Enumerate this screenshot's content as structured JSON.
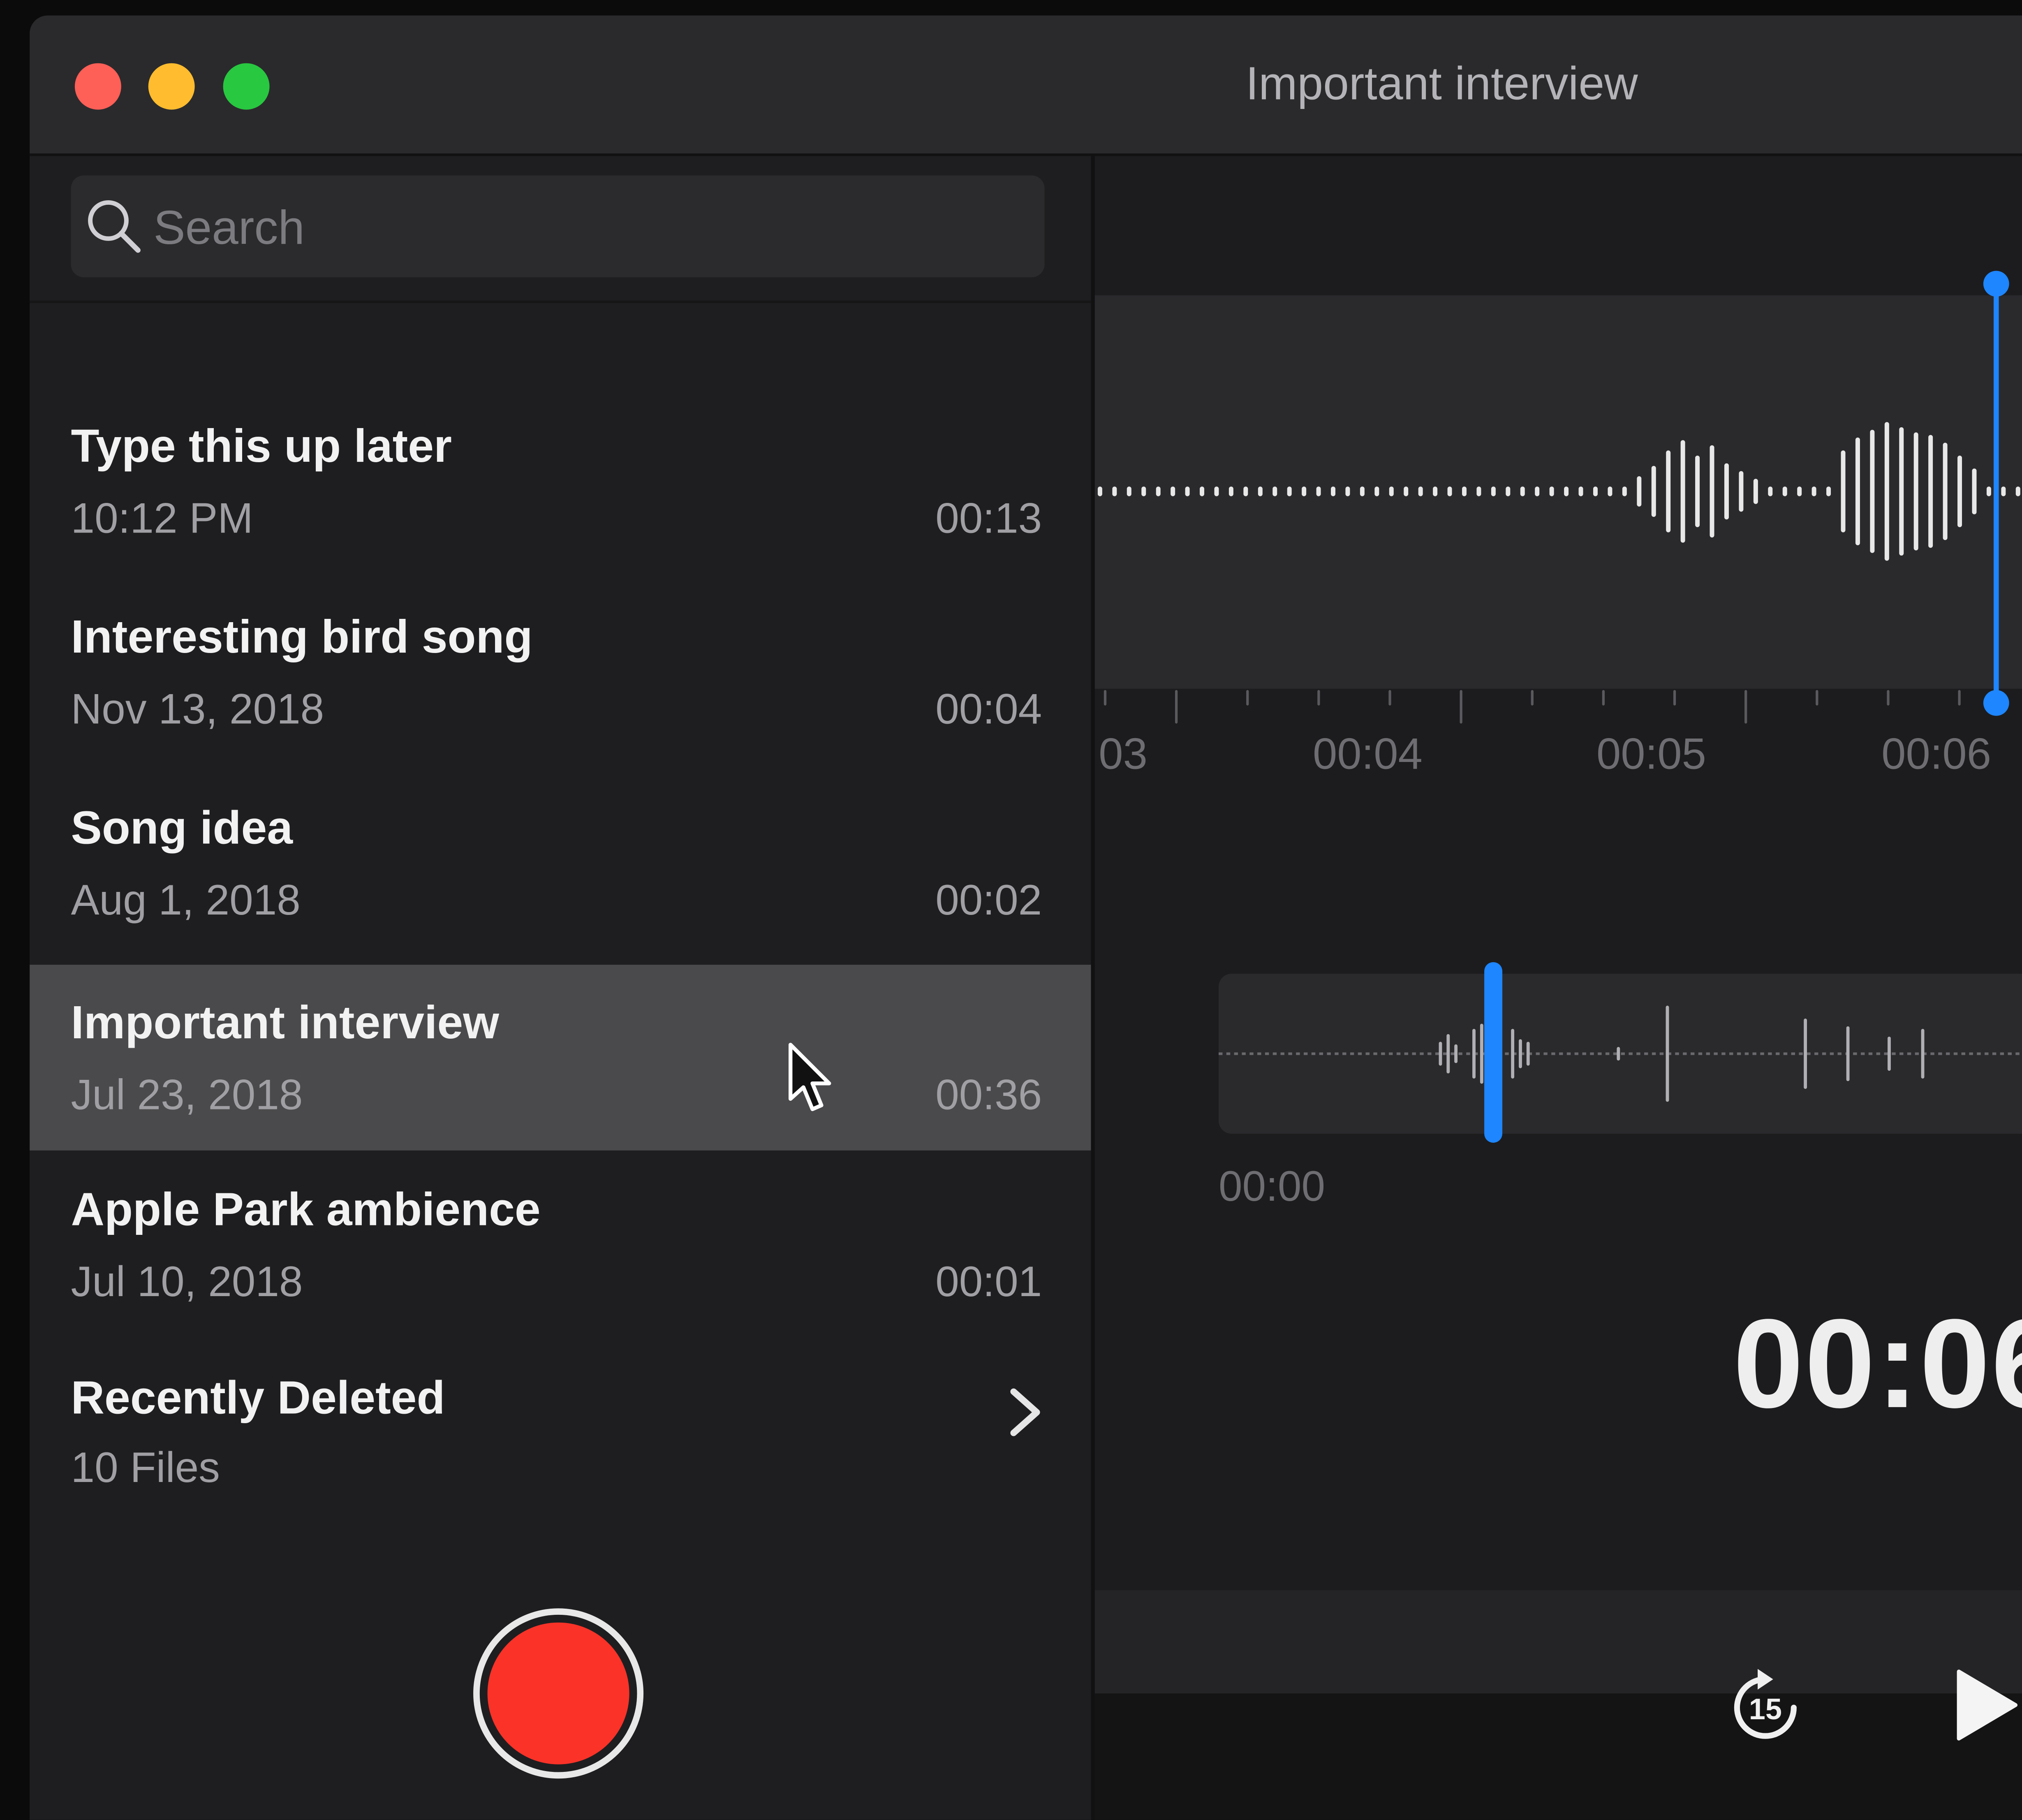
{
  "window": {
    "title": "Important interview"
  },
  "sidebar": {
    "search": {
      "placeholder": "Search",
      "value": ""
    },
    "recordings": [
      {
        "name": "Type this up later",
        "date": "10:12 PM",
        "duration": "00:13",
        "selected": false
      },
      {
        "name": "Interesting bird song",
        "date": "Nov 13, 2018",
        "duration": "00:04",
        "selected": false
      },
      {
        "name": "Song idea",
        "date": "Aug 1, 2018",
        "duration": "00:02",
        "selected": false
      },
      {
        "name": "Important interview",
        "date": "Jul 23, 2018",
        "duration": "00:36",
        "selected": true
      },
      {
        "name": "Apple Park ambience",
        "date": "Jul 10, 2018",
        "duration": "00:01",
        "selected": false
      }
    ],
    "recently_deleted": {
      "label": "Recently Deleted",
      "count": "10 Files"
    }
  },
  "main": {
    "timeline_ticks": [
      "03",
      "00:04",
      "00:05",
      "00:06"
    ],
    "overview_start": "00:00",
    "current_time": "00:06"
  },
  "colors": {
    "accent": "#1e86ff",
    "record": "#fa3228",
    "close": "#fe5f57",
    "minimize": "#febc2e",
    "zoom": "#28c840"
  },
  "icons": {
    "search": "search-icon",
    "chevron": "chevron-right-icon",
    "skip": "skip-back-15-icon",
    "play": "play-icon"
  }
}
